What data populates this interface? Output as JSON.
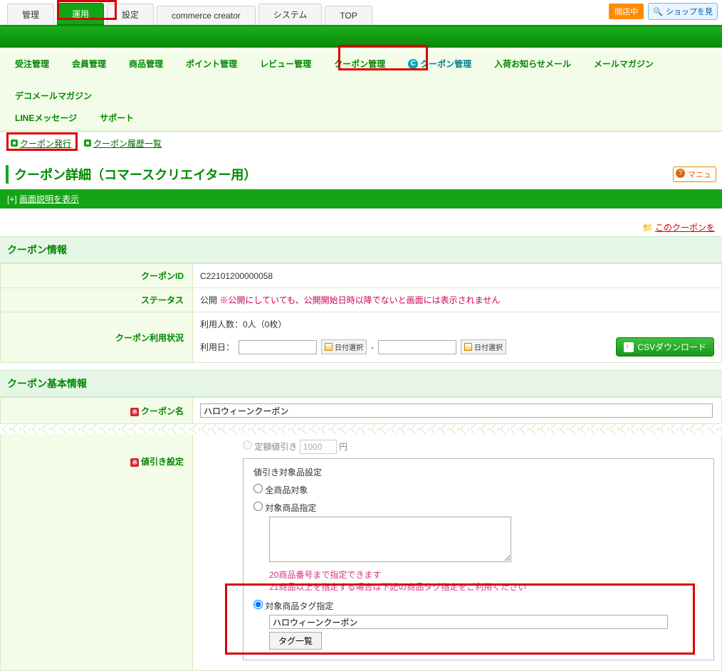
{
  "top_tabs": {
    "t0": "管理",
    "t1": "運用",
    "t2": "設定",
    "t3": "commerce creator",
    "t4": "システム",
    "t5": "TOP"
  },
  "top_right": {
    "open": "開店中",
    "shop": "ショップを見"
  },
  "subnav": {
    "r0": "受注管理",
    "r1": "会員管理",
    "r2": "商品管理",
    "r3": "ポイント管理",
    "r4": "レビュー管理",
    "r5": "クーポン管理",
    "r6": "クーポン管理",
    "r7": "入荷お知らせメール",
    "r8": "メールマガジン",
    "r9": "デコメールマガジン",
    "r10": "LINEメッセージ",
    "r11": "サポート"
  },
  "linkrow": {
    "l0": "クーポン発行",
    "l1": "クーポン履歴一覧"
  },
  "page_title": "クーポン詳細（コマースクリエイター用）",
  "manual": "マニュ",
  "hint_prefix": "[+] ",
  "hint": "画面説明を表示",
  "delete_link": "このクーポンを",
  "sec1": "クーポン情報",
  "rows": {
    "id_label": "クーポンID",
    "id_val": "C22101200000058",
    "status_label": "ステータス",
    "status_val": "公開",
    "status_note": "※公開にしていても、公開開始日時以降でないと画面には表示されません",
    "usage_label": "クーポン利用状況",
    "usage_count": "利用人数：0人（0枚）",
    "usage_date_label": "利用日：",
    "date_btn": "日付選択",
    "sep": "-",
    "csv": "CSVダウンロード"
  },
  "sec2": "クーポン基本情報",
  "name_label": "クーポン名",
  "name_val": "ハロウィーンクーポン",
  "discount_label": "値引き設定",
  "upper": {
    "label": "定額値引き",
    "val": "1000",
    "unit": "円"
  },
  "fs": {
    "legend": "値引き対象品設定",
    "opt_all": "全商品対象",
    "opt_prod": "対象商品指定",
    "note1": "20商品番号まで指定できます",
    "note2": "21商品以上を指定する場合は下記の商品タグ指定をご利用ください",
    "opt_tag": "対象商品タグ指定",
    "tag_val": "ハロウィーンクーポン",
    "tag_btn": "タグ一覧"
  },
  "req": "※"
}
